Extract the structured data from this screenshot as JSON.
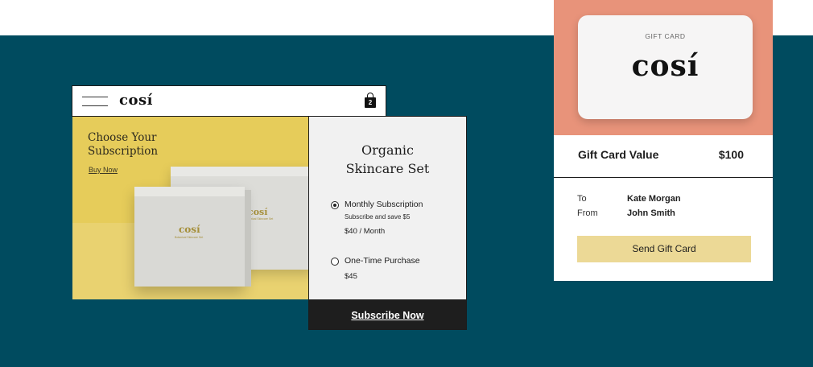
{
  "store": {
    "logo": "cosí",
    "cart_count": "2",
    "hero": {
      "title": "Choose Your\nSubscription",
      "link": "Buy Now",
      "box_logo": "cosí",
      "box_subtitle": "Botanical Skincare Set"
    }
  },
  "product": {
    "title": "Organic\nSkincare Set",
    "options": [
      {
        "label": "Monthly Subscription",
        "sub": "Subscribe and save $5",
        "price": "$40 / Month",
        "selected": true
      },
      {
        "label": "One-Time Purchase",
        "sub": "",
        "price": "$45",
        "selected": false
      }
    ],
    "cta": "Subscribe Now"
  },
  "gift": {
    "card_label": "GIFT CARD",
    "card_logo": "cosí",
    "value_label": "Gift Card Value",
    "value_amount": "$100",
    "to_label": "To",
    "to_value": "Kate Morgan",
    "from_label": "From",
    "from_value": "John Smith",
    "send_label": "Send Gift Card"
  },
  "colors": {
    "background": "#004b5f",
    "hero_yellow": "#e6cc5a",
    "gift_coral": "#e8937a",
    "send_button": "#ecd996",
    "cta_dark": "#1e1e1e"
  }
}
